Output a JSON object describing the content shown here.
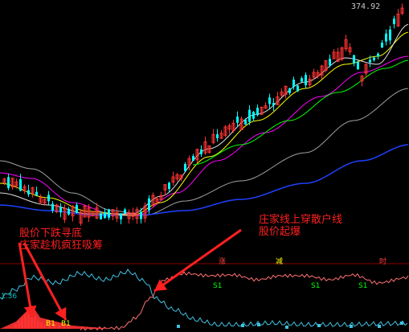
{
  "price_label": "374.92",
  "annotations": {
    "bottom_title_line1": "股价下跌寻底",
    "bottom_title_line2": "庄家趁机疯狂吸筹",
    "breakout_line1": "庄家线上穿散户线",
    "breakout_line2": "股价起爆"
  },
  "signals": {
    "zhang": "涨",
    "jian": "减",
    "shi": "时",
    "s1_a": "S1",
    "s1_b": "S1",
    "s1_c": "S1",
    "b1_a": "B1",
    "b1_b": "B1",
    "left_tag": "1.36"
  },
  "colors": {
    "background": "#000000",
    "candle_up": "#ff3232",
    "candle_down": "#00ffff",
    "ma_white": "#e0e0e0",
    "ma_yellow": "#ffff00",
    "ma_magenta": "#ff00ff",
    "ma_green": "#00ff00",
    "ma_gray": "#a0a0a0",
    "ma_blue": "#2040ff",
    "banker_line": "#ff7070",
    "retail_line": "#40c0e0",
    "annotation": "#ff2020",
    "divider": "#8b0000"
  }
}
